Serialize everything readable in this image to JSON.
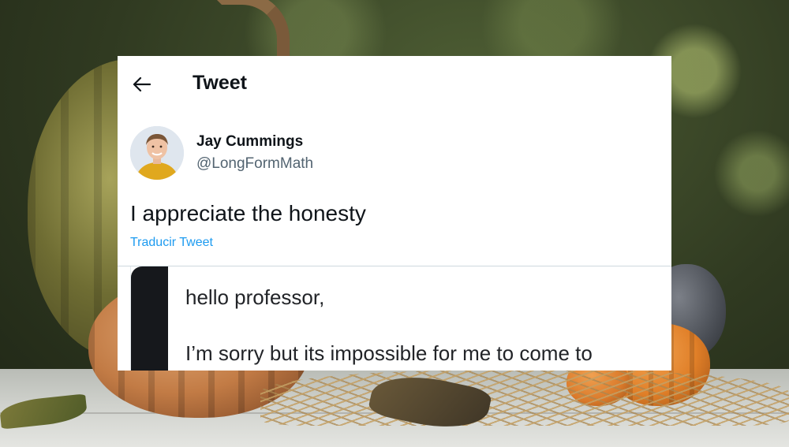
{
  "header": {
    "title": "Tweet",
    "back_icon": "arrow-left-icon"
  },
  "tweet": {
    "author_name": "Jay Cummings",
    "author_handle": "@LongFormMath",
    "text": "I appreciate the honesty",
    "translate_label": "Traducir Tweet",
    "media_text_lines": [
      "hello professor,",
      "I’m sorry but its impossible for me to come to"
    ]
  },
  "colors": {
    "link": "#1d9bf0",
    "text_primary": "#0f1419",
    "text_secondary": "#536471"
  }
}
